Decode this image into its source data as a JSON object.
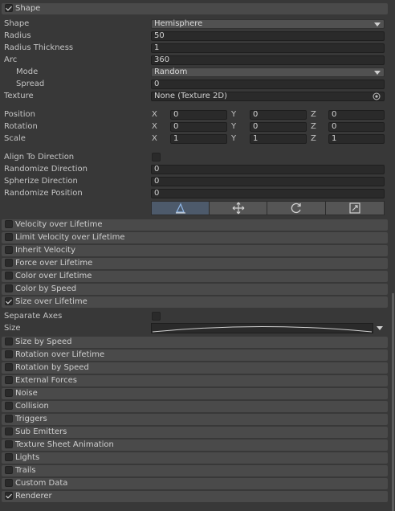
{
  "shape_module": {
    "title": "Shape",
    "enabled": true
  },
  "labels": {
    "shape": "Shape",
    "radius": "Radius",
    "radius_thickness": "Radius Thickness",
    "arc": "Arc",
    "mode": "Mode",
    "spread": "Spread",
    "texture": "Texture",
    "position": "Position",
    "rotation": "Rotation",
    "scale": "Scale",
    "align_to_direction": "Align To Direction",
    "randomize_direction": "Randomize Direction",
    "spherize_direction": "Spherize Direction",
    "randomize_position": "Randomize Position",
    "separate_axes": "Separate Axes",
    "size": "Size"
  },
  "values": {
    "shape": "Hemisphere",
    "radius": "50",
    "radius_thickness": "1",
    "arc": "360",
    "mode": "Random",
    "spread": "0",
    "texture": "None (Texture 2D)",
    "randomize_direction": "0",
    "spherize_direction": "0",
    "randomize_position": "0"
  },
  "axis": {
    "x": "X",
    "y": "Y",
    "z": "Z"
  },
  "transform": {
    "position": {
      "x": "0",
      "y": "0",
      "z": "0"
    },
    "rotation": {
      "x": "0",
      "y": "0",
      "z": "0"
    },
    "scale": {
      "x": "1",
      "y": "1",
      "z": "1"
    }
  },
  "modules": [
    {
      "label": "Velocity over Lifetime",
      "enabled": false
    },
    {
      "label": "Limit Velocity over Lifetime",
      "enabled": false
    },
    {
      "label": "Inherit Velocity",
      "enabled": false
    },
    {
      "label": "Force over Lifetime",
      "enabled": false
    },
    {
      "label": "Color over Lifetime",
      "enabled": false
    },
    {
      "label": "Color by Speed",
      "enabled": false
    },
    {
      "label": "Size over Lifetime",
      "enabled": true
    },
    {
      "label": "Size by Speed",
      "enabled": false
    },
    {
      "label": "Rotation over Lifetime",
      "enabled": false
    },
    {
      "label": "Rotation by Speed",
      "enabled": false
    },
    {
      "label": "External Forces",
      "enabled": false
    },
    {
      "label": "Noise",
      "enabled": false
    },
    {
      "label": "Collision",
      "enabled": false
    },
    {
      "label": "Triggers",
      "enabled": false
    },
    {
      "label": "Sub Emitters",
      "enabled": false
    },
    {
      "label": "Texture Sheet Animation",
      "enabled": false
    },
    {
      "label": "Lights",
      "enabled": false
    },
    {
      "label": "Trails",
      "enabled": false
    },
    {
      "label": "Custom Data",
      "enabled": false
    },
    {
      "label": "Renderer",
      "enabled": true
    }
  ],
  "icons": {
    "tool_buttons": [
      "edit-shape-icon",
      "move-icon",
      "rotate-icon",
      "scale-icon"
    ],
    "texture_picker": "object-picker-icon",
    "size_curve_menu": "chevron-down-icon"
  }
}
